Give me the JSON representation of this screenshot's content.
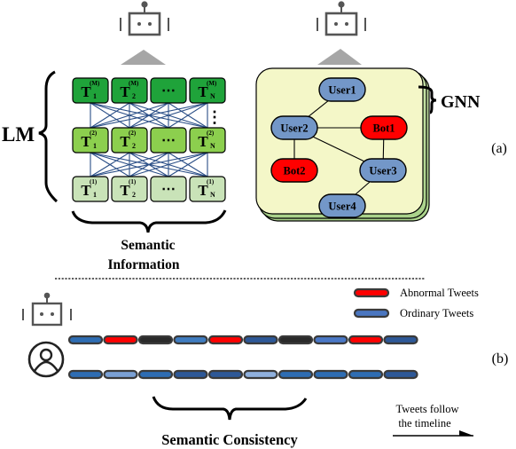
{
  "panel_a": {
    "label": "(a)",
    "lm": {
      "label": "LM",
      "layers": [
        {
          "superscript": "(M)",
          "color": "#1fa33a",
          "tokens": [
            "T",
            "T",
            "⋯",
            "T"
          ],
          "subscripts": [
            "1",
            "2",
            "",
            "N"
          ]
        },
        {
          "superscript": "(2)",
          "color": "#8ccf4e",
          "tokens": [
            "T",
            "T",
            "⋯",
            "T"
          ],
          "subscripts": [
            "1",
            "2",
            "",
            "N"
          ]
        },
        {
          "superscript": "(1)",
          "color": "#c9e3b8",
          "tokens": [
            "T",
            "T",
            "⋯",
            "T"
          ],
          "subscripts": [
            "1",
            "2",
            "",
            "N"
          ]
        }
      ],
      "vertical_ellipsis": "⋮",
      "connection_color": "#2b4f87",
      "brace_label_line1": "Semantic",
      "brace_label_line2": "Information"
    },
    "gnn": {
      "label": "GNN",
      "panel_color": "#f4f7c8",
      "layer_color": "#b6d99a",
      "nodes": [
        {
          "id": "user1",
          "label": "User1",
          "type": "user"
        },
        {
          "id": "user2",
          "label": "User2",
          "type": "user"
        },
        {
          "id": "bot1",
          "label": "Bot1",
          "type": "bot"
        },
        {
          "id": "bot2",
          "label": "Bot2",
          "type": "bot"
        },
        {
          "id": "user3",
          "label": "User3",
          "type": "user"
        },
        {
          "id": "user4",
          "label": "User4",
          "type": "user"
        }
      ],
      "edges": [
        [
          "user1",
          "user2"
        ],
        [
          "user2",
          "bot1"
        ],
        [
          "user2",
          "bot2"
        ],
        [
          "user2",
          "user3"
        ],
        [
          "bot1",
          "user3"
        ],
        [
          "user3",
          "user4"
        ]
      ],
      "user_color": "#7397c8",
      "bot_color": "#ff0000"
    },
    "icons": [
      "robot-icon",
      "robot-icon"
    ]
  },
  "panel_b": {
    "label": "(b)",
    "legend": [
      {
        "label": "Abnormal Tweets",
        "color": "#ff0000"
      },
      {
        "label": "Ordinary Tweets",
        "color": "#4a76c0"
      }
    ],
    "sequences": [
      {
        "subject": "robot-icon",
        "tweets": [
          "#2e6db3",
          "#ff0000",
          "#2a2a2a",
          "#3f7cc0",
          "#ff0000",
          "#2d5897",
          "#2a2a2a",
          "#4a78c6",
          "#ff0000",
          "#2d5897"
        ]
      },
      {
        "subject": "user-icon",
        "tweets": [
          "#2e6db3",
          "#7aa0d4",
          "#2e6db3",
          "#2d5897",
          "#2d5897",
          "#8fb0dd",
          "#2e6db3",
          "#2e6db3",
          "#2e6db3",
          "#2d5897"
        ]
      }
    ],
    "brace_label": "Semantic Consistency",
    "timeline_line1": "Tweets follow",
    "timeline_line2": "the timeline"
  }
}
